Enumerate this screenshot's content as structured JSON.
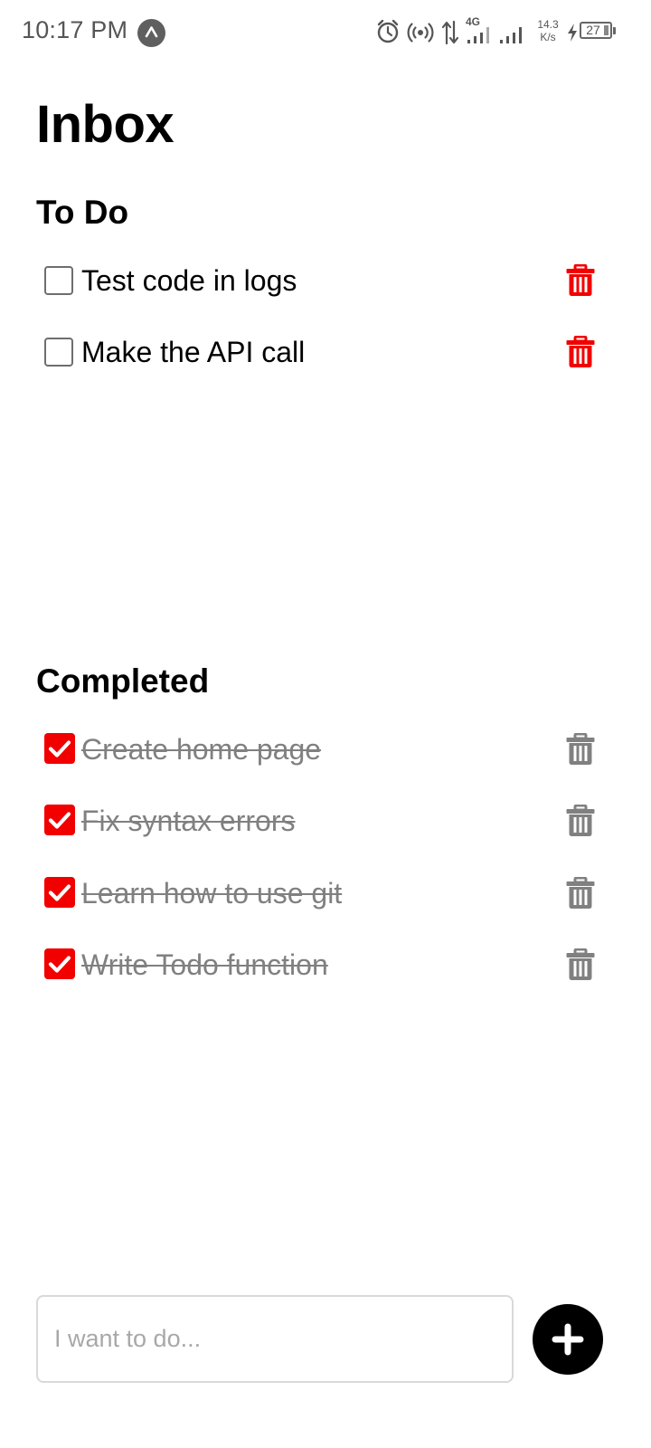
{
  "status_bar": {
    "time": "10:17 PM",
    "network_type": "4G",
    "net_speed_value": "14.3",
    "net_speed_unit": "K/s",
    "battery": "27",
    "icons": [
      "app-notification-icon",
      "alarm-icon",
      "hotspot-icon",
      "data-transfer-icon",
      "signal-icon",
      "signal-icon",
      "charging-icon",
      "battery-icon"
    ]
  },
  "page": {
    "title": "Inbox"
  },
  "todo": {
    "heading": "To Do",
    "items": [
      {
        "label": "Test code in logs",
        "checked": false
      },
      {
        "label": "Make the API call",
        "checked": false
      }
    ]
  },
  "completed": {
    "heading": "Completed",
    "items": [
      {
        "label": "Create home page",
        "checked": true
      },
      {
        "label": "Fix syntax errors",
        "checked": true
      },
      {
        "label": "Learn how to use git",
        "checked": true
      },
      {
        "label": "Write Todo function",
        "checked": true
      }
    ]
  },
  "composer": {
    "placeholder": "I want to do...",
    "value": ""
  },
  "colors": {
    "accent": "#f20000",
    "delete_active": "#f20000",
    "delete_completed": "#808080",
    "done_text": "#808080",
    "add_button": "#000000"
  }
}
